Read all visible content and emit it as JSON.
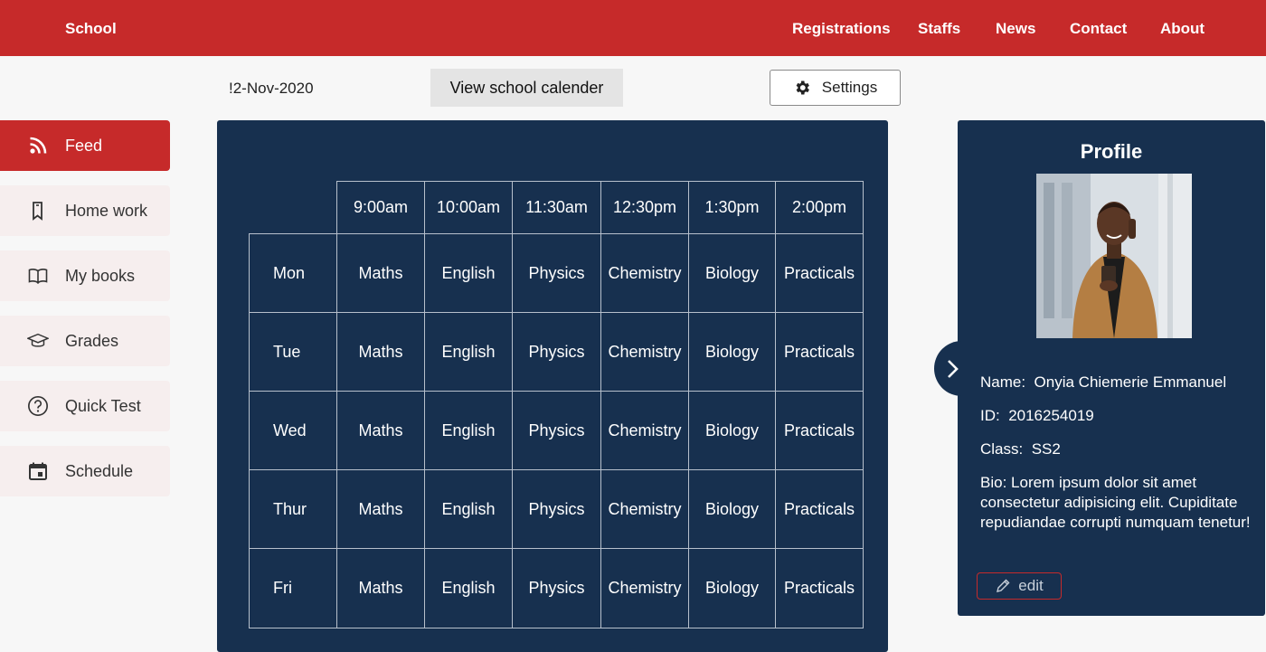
{
  "header": {
    "brand": "School",
    "nav": [
      "Registrations",
      "Staffs",
      "News",
      "Contact",
      "About"
    ]
  },
  "toolbar": {
    "date": "!2-Nov-2020",
    "calendar_label": "View school calender",
    "settings_label": "Settings"
  },
  "sidebar": {
    "items": [
      {
        "label": "Feed",
        "icon": "rss-icon",
        "active": true
      },
      {
        "label": "Home work",
        "icon": "bookmark-icon"
      },
      {
        "label": "My books",
        "icon": "book-icon"
      },
      {
        "label": "Grades",
        "icon": "graduation-cap-icon"
      },
      {
        "label": "Quick Test",
        "icon": "question-circle-icon"
      },
      {
        "label": "Schedule",
        "icon": "calendar-icon"
      }
    ]
  },
  "timetable": {
    "times": [
      "9:00am",
      "10:00am",
      "11:30am",
      "12:30pm",
      "1:30pm",
      "2:00pm"
    ],
    "rows": [
      {
        "day": "Mon",
        "subjects": [
          "Maths",
          "English",
          "Physics",
          "Chemistry",
          "Biology",
          "Practicals"
        ]
      },
      {
        "day": "Tue",
        "subjects": [
          "Maths",
          "English",
          "Physics",
          "Chemistry",
          "Biology",
          "Practicals"
        ]
      },
      {
        "day": "Wed",
        "subjects": [
          "Maths",
          "English",
          "Physics",
          "Chemistry",
          "Biology",
          "Practicals"
        ]
      },
      {
        "day": "Thur",
        "subjects": [
          "Maths",
          "English",
          "Physics",
          "Chemistry",
          "Biology",
          "Practicals"
        ]
      },
      {
        "day": "Fri",
        "subjects": [
          "Maths",
          "English",
          "Physics",
          "Chemistry",
          "Biology",
          "Practicals"
        ]
      }
    ]
  },
  "profile": {
    "title": "Profile",
    "name_label": "Name:",
    "name": "Onyia Chiemerie Emmanuel",
    "id_label": "ID:",
    "id": "2016254019",
    "class_label": "Class:",
    "class": "SS2",
    "bio_label": "Bio:",
    "bio": "Lorem ipsum dolor sit amet consectetur adipisicing elit. Cupiditate repudiandae corrupti numquam tenetur!",
    "edit_label": "edit"
  },
  "colors": {
    "brand": "#c62a2a",
    "panel": "#17304f",
    "sidebar_item": "#f6eeee"
  }
}
